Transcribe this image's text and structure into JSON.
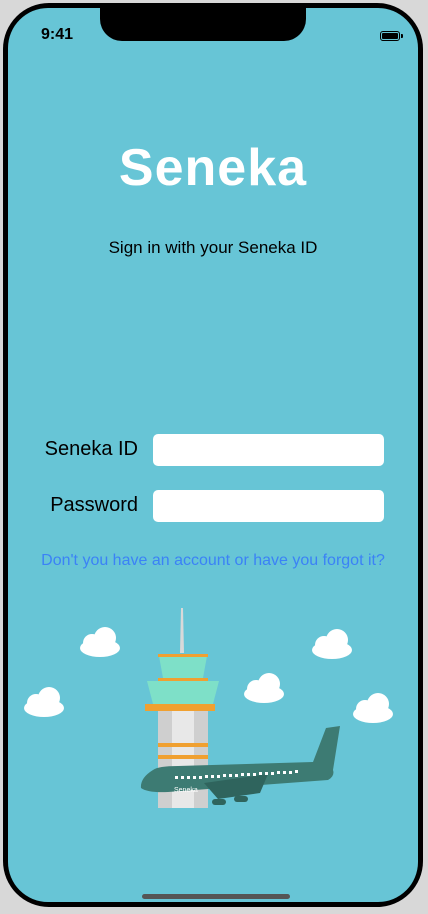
{
  "status_bar": {
    "time": "9:41"
  },
  "brand": {
    "name": "Seneka"
  },
  "signin": {
    "subtitle": "Sign in with your Seneka ID"
  },
  "form": {
    "id_label": "Seneka ID",
    "id_value": "",
    "password_label": "Password",
    "password_value": ""
  },
  "link": {
    "forgot": "Don't you have an account or have you forgot it?"
  },
  "illustration": {
    "plane_text": "Seneka"
  },
  "colors": {
    "background": "#67c5d6",
    "link": "#3b82f6",
    "tower_top": "#7ee0c8",
    "tower_band": "#f0a030",
    "plane": "#3d7b73"
  },
  "icons": [
    "battery-icon",
    "cloud-icon",
    "control-tower-icon",
    "airplane-icon"
  ]
}
